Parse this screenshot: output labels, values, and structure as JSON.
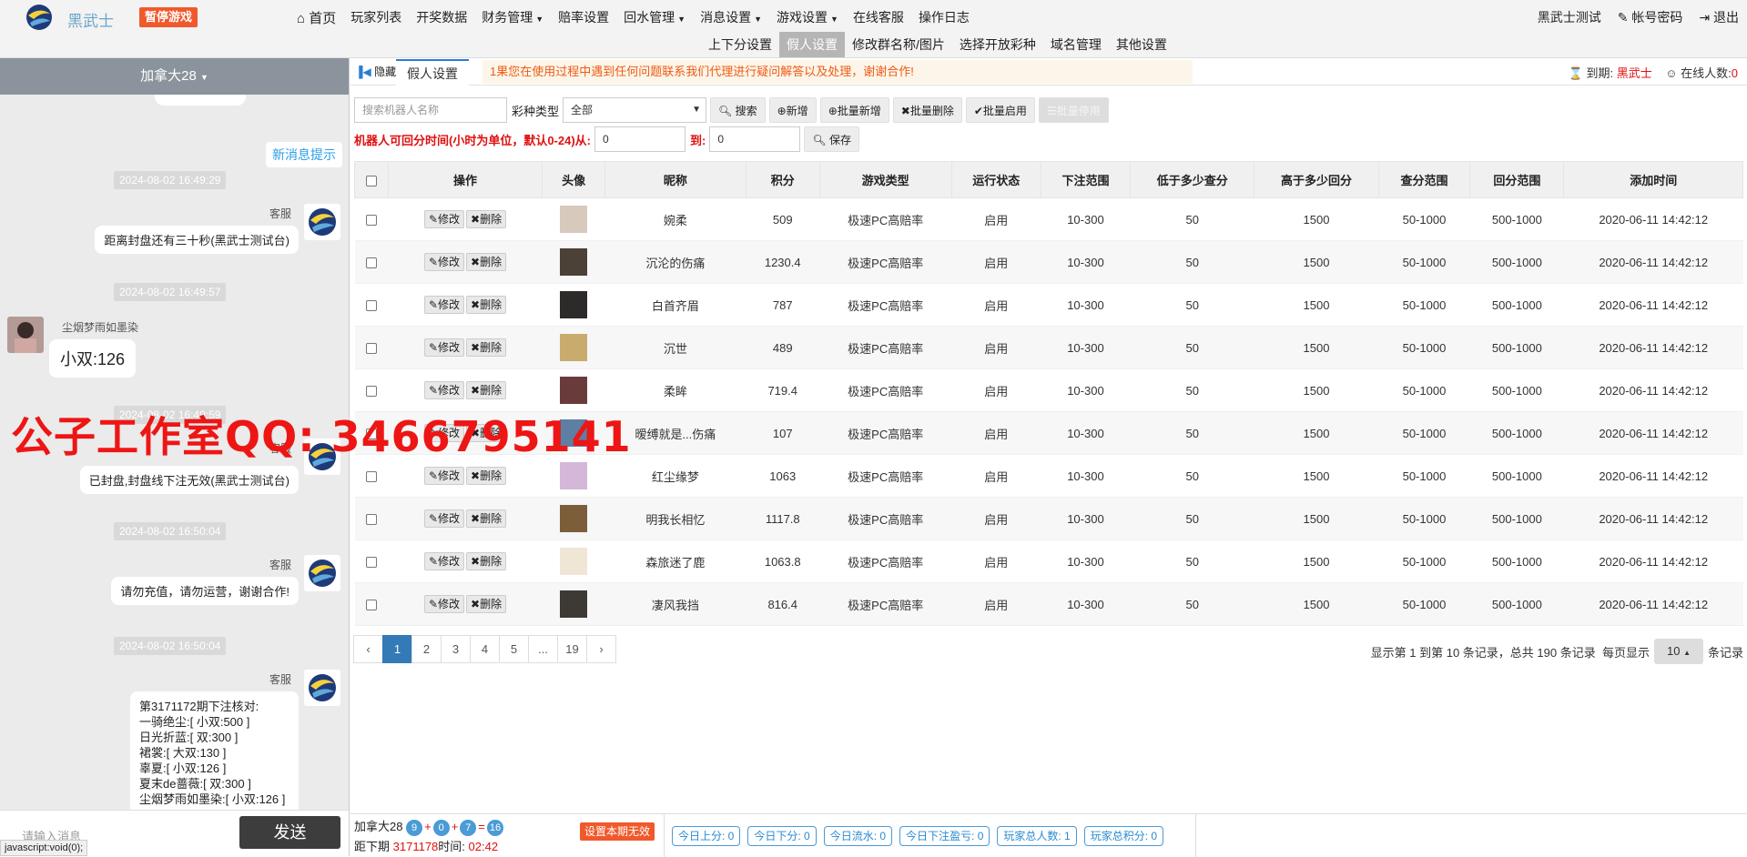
{
  "header": {
    "site_name": "黑武士",
    "pause_label": "暂停游戏",
    "menu": [
      {
        "label": "首页",
        "icon": "home-icon"
      },
      {
        "label": "玩家列表"
      },
      {
        "label": "开奖数据"
      },
      {
        "label": "财务管理",
        "dropdown": true
      },
      {
        "label": "赔率设置"
      },
      {
        "label": "回水管理",
        "dropdown": true
      },
      {
        "label": "消息设置",
        "dropdown": true
      },
      {
        "label": "游戏设置",
        "dropdown": true
      },
      {
        "label": "在线客服"
      },
      {
        "label": "操作日志"
      }
    ],
    "submenu": [
      "上下分设置",
      "假人设置",
      "修改群名称/图片",
      "选择开放彩种",
      "域名管理",
      "其他设置"
    ],
    "submenu_active": "假人设置",
    "right": {
      "user": "黑武士测试",
      "password": "帐号密码",
      "logout": "退出"
    }
  },
  "chat": {
    "room": "加拿大28",
    "new_msg": "新消息提示",
    "messages": [
      {
        "time": "2024-08-02 16:49:29",
        "sender": "客服",
        "text": "距离封盘还有三十秒(黑武士测试台)"
      },
      {
        "time": "2024-08-02 16:49:57",
        "sender": "尘烟梦雨如墨染",
        "text": "小双:126"
      },
      {
        "time": "2024-08-02 16:49:59",
        "sender": "客服",
        "text": "已封盘,封盘线下注无效(黑武士测试台)"
      },
      {
        "time": "2024-08-02 16:50:04",
        "sender": "客服",
        "text": "请勿充值，请勿运营，谢谢合作!"
      },
      {
        "time": "2024-08-02 16:50:04",
        "sender": "客服",
        "text": "第3171172期下注核对:\n一骑绝尘:[ 小双:500 ]\n日光折蓝:[ 双:300 ]\n裙裳:[ 大双:130 ]\n辜夏:[ 小双:126 ]\n夏末de蔷薇:[ 双:300 ]\n尘烟梦雨如墨染:[ 小双:126 ]\n\n================"
      }
    ],
    "input_placeholder": "请输入消息",
    "send_label": "发送",
    "status_url": "javascript:void(0);"
  },
  "watermark": "公子工作室QQ: 3466795141",
  "main": {
    "hide_label": "隐藏",
    "tab_label": "假人设置",
    "notice": "1果您在使用过程中遇到任何问题联系我们代理进行疑问解答以及处理，谢谢合作!",
    "expiry_label": "到期:",
    "expiry_value": "黑武士",
    "online_label": "在线人数:",
    "online_value": "0",
    "search_placeholder": "搜索机器人名称",
    "lottery_label": "彩种类型",
    "lottery_value": "全部",
    "buttons": {
      "search": "搜索",
      "add": "新增",
      "batch_add": "批量新增",
      "batch_delete": "批量删除",
      "batch_enable": "批量启用",
      "batch_disable": "批量停用",
      "save": "保存"
    },
    "range_label": "机器人可回分时间(小时为单位，默认0-24)从:",
    "range_from": "0",
    "range_to_label": "到:",
    "range_to": "0",
    "columns": [
      "操作",
      "头像",
      "昵称",
      "积分",
      "游戏类型",
      "运行状态",
      "下注范围",
      "低于多少查分",
      "高于多少回分",
      "查分范围",
      "回分范围",
      "添加时间"
    ],
    "edit_label": "修改",
    "delete_label": "删除",
    "rows": [
      {
        "nick": "婉柔",
        "score": "509",
        "game": "极速PC高赔率",
        "status": "启用",
        "bet": "10-300",
        "low": "50",
        "high": "1500",
        "check": "50-1000",
        "back": "500-1000",
        "time": "2020-06-11 14:42:12",
        "av": "#d8c9bd"
      },
      {
        "nick": "沉沦的伤痛",
        "score": "1230.4",
        "game": "极速PC高赔率",
        "status": "启用",
        "bet": "10-300",
        "low": "50",
        "high": "1500",
        "check": "50-1000",
        "back": "500-1000",
        "time": "2020-06-11 14:42:12",
        "av": "#4b4136"
      },
      {
        "nick": "白首齐眉",
        "score": "787",
        "game": "极速PC高赔率",
        "status": "启用",
        "bet": "10-300",
        "low": "50",
        "high": "1500",
        "check": "50-1000",
        "back": "500-1000",
        "time": "2020-06-11 14:42:12",
        "av": "#2d2a2a"
      },
      {
        "nick": "沉世",
        "score": "489",
        "game": "极速PC高赔率",
        "status": "启用",
        "bet": "10-300",
        "low": "50",
        "high": "1500",
        "check": "50-1000",
        "back": "500-1000",
        "time": "2020-06-11 14:42:12",
        "av": "#c9ab6e"
      },
      {
        "nick": "柔眸",
        "score": "719.4",
        "game": "极速PC高赔率",
        "status": "启用",
        "bet": "10-300",
        "low": "50",
        "high": "1500",
        "check": "50-1000",
        "back": "500-1000",
        "time": "2020-06-11 14:42:12",
        "av": "#6a3b3b"
      },
      {
        "nick": "暧缚就是...伤痛",
        "score": "107",
        "game": "极速PC高赔率",
        "status": "启用",
        "bet": "10-300",
        "low": "50",
        "high": "1500",
        "check": "50-1000",
        "back": "500-1000",
        "time": "2020-06-11 14:42:12",
        "av": "#5d7fa3"
      },
      {
        "nick": "红尘缘梦",
        "score": "1063",
        "game": "极速PC高赔率",
        "status": "启用",
        "bet": "10-300",
        "low": "50",
        "high": "1500",
        "check": "50-1000",
        "back": "500-1000",
        "time": "2020-06-11 14:42:12",
        "av": "#d4b7d9"
      },
      {
        "nick": "明我长相忆",
        "score": "1117.8",
        "game": "极速PC高赔率",
        "status": "启用",
        "bet": "10-300",
        "low": "50",
        "high": "1500",
        "check": "50-1000",
        "back": "500-1000",
        "time": "2020-06-11 14:42:12",
        "av": "#7d5e3a"
      },
      {
        "nick": "森旅迷了鹿",
        "score": "1063.8",
        "game": "极速PC高赔率",
        "status": "启用",
        "bet": "10-300",
        "low": "50",
        "high": "1500",
        "check": "50-1000",
        "back": "500-1000",
        "time": "2020-06-11 14:42:12",
        "av": "#efe6d6"
      },
      {
        "nick": "凄风我挡",
        "score": "816.4",
        "game": "极速PC高赔率",
        "status": "启用",
        "bet": "10-300",
        "low": "50",
        "high": "1500",
        "check": "50-1000",
        "back": "500-1000",
        "time": "2020-06-11 14:42:12",
        "av": "#3d3a36"
      }
    ],
    "pager": [
      "‹",
      "1",
      "2",
      "3",
      "4",
      "5",
      "...",
      "19",
      "›"
    ],
    "pager_active": "1",
    "pager_info": "显示第 1 到第 10 条记录，总共 190 条记录",
    "per_page_label": "每页显示",
    "per_page_value": "10",
    "per_page_suffix": "条记录"
  },
  "bottom": {
    "game": "加拿大28",
    "balls": [
      "9",
      "0",
      "7",
      "16"
    ],
    "next_label": "距下期",
    "next_issue": "3171178",
    "time_label": "时间:",
    "time_value": "02:42",
    "invalid_label": "设置本期无效",
    "stats": [
      "今日上分: 0",
      "今日下分: 0",
      "今日流水: 0",
      "今日下注盈亏: 0",
      "玩家总人数: 1",
      "玩家总积分: 0"
    ]
  }
}
